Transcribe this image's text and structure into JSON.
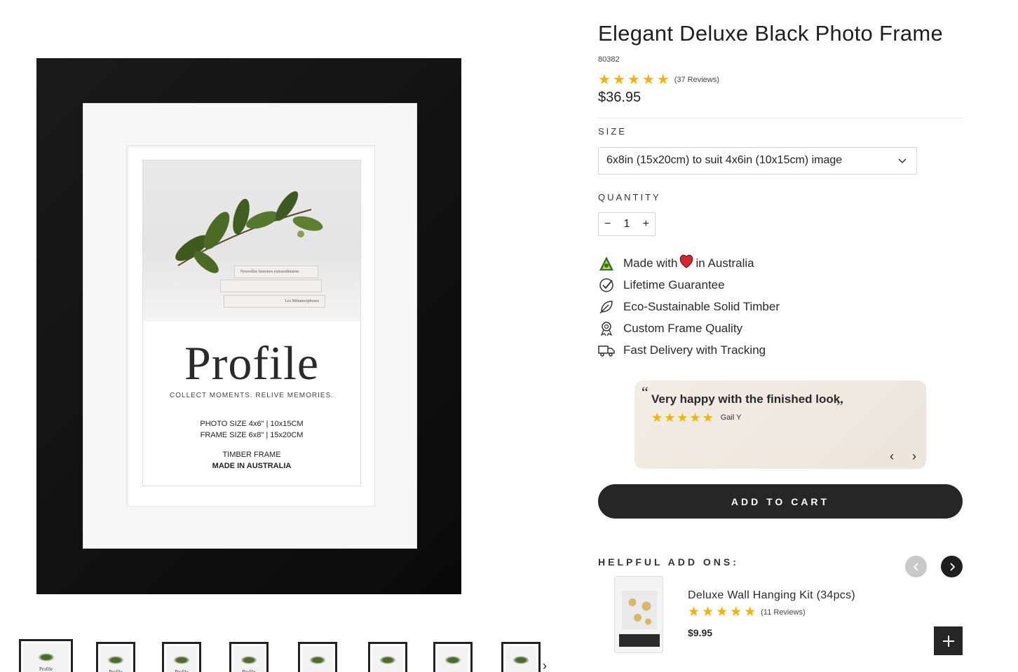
{
  "product": {
    "title": "Elegant Deluxe Black Photo Frame",
    "sku": "80382",
    "rating": 5,
    "reviews_label": "(37 Reviews)",
    "price": "$36.95"
  },
  "image": {
    "brand_word": "Profile",
    "tagline": "COLLECT MOMENTS. RELIVE MEMORIES.",
    "photo_size": "PHOTO SIZE 4x6\" | 10x15CM",
    "frame_size": "FRAME SIZE 6x8\" | 15x20CM",
    "timber": "TIMBER FRAME",
    "made_in": "MADE IN AUSTRALIA",
    "book_titles": [
      "Nouvelles histoires extraordinaires",
      "Les Métamorphoses"
    ]
  },
  "thumbnails": {
    "count": 8,
    "label": "Profile",
    "next_icon": "chevron-right-icon"
  },
  "size": {
    "label": "SIZE",
    "selected": "6x8in (15x20cm) to suit 4x6in (10x15cm) image"
  },
  "quantity": {
    "label": "QUANTITY",
    "value": "1",
    "minus": "−",
    "plus": "+"
  },
  "features": [
    {
      "icon": "australian-made-icon",
      "text_before": "Made with",
      "text_after": "in Australia"
    },
    {
      "icon": "check-badge-icon",
      "text": "Lifetime Guarantee"
    },
    {
      "icon": "leaf-icon",
      "text": "Eco-Sustainable Solid Timber"
    },
    {
      "icon": "award-ribbon-icon",
      "text": "Custom Frame Quality"
    },
    {
      "icon": "truck-icon",
      "text": "Fast Delivery with Tracking"
    }
  ],
  "review": {
    "open_quote": "“",
    "text": "Very happy with the finished look.",
    "close_quote": "”",
    "rating": 5,
    "reviewer": "Gail Y"
  },
  "cart": {
    "label": "ADD TO CART"
  },
  "addons": {
    "label": "HELPFUL ADD ONS:",
    "items": [
      {
        "name": "Deluxe Wall Hanging Kit (34pcs)",
        "rating": 5,
        "reviews_label": "(11 Reviews)",
        "price": "$9.95"
      }
    ]
  },
  "colors": {
    "star": "#f5b301",
    "button_dark": "#262626",
    "review_bg": "#f0ebe3"
  }
}
